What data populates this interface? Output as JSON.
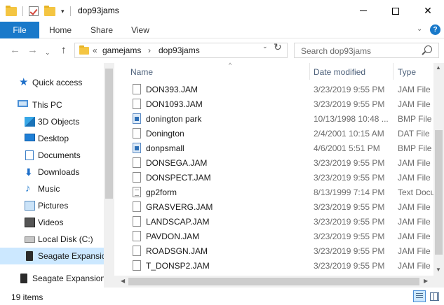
{
  "window": {
    "title": "dop93jams",
    "qa_dropdown_glyph": "▾",
    "minimize_label": "",
    "close_glyph": "✕"
  },
  "ribbon": {
    "tabs": [
      "File",
      "Home",
      "Share",
      "View"
    ],
    "expand_glyph": "⌄",
    "help_glyph": "?"
  },
  "address": {
    "back_glyph": "←",
    "forward_glyph": "→",
    "recent_glyph": "⌄",
    "up_glyph": "↑",
    "prefix": "«",
    "crumbs": [
      "gamejams",
      "dop93jams"
    ],
    "sep": "›",
    "chevron_glyph": "⌄",
    "refresh_glyph": "↻"
  },
  "search": {
    "placeholder": "Search dop93jams"
  },
  "nav": {
    "items": [
      {
        "label": "Quick access",
        "icon": "star-icon"
      },
      {
        "label": "This PC",
        "icon": "computer-icon"
      },
      {
        "label": "3D Objects",
        "icon": "3d-objects-icon"
      },
      {
        "label": "Desktop",
        "icon": "desktop-icon"
      },
      {
        "label": "Documents",
        "icon": "documents-icon"
      },
      {
        "label": "Downloads",
        "icon": "downloads-icon"
      },
      {
        "label": "Music",
        "icon": "music-icon"
      },
      {
        "label": "Pictures",
        "icon": "pictures-icon"
      },
      {
        "label": "Videos",
        "icon": "videos-icon"
      },
      {
        "label": "Local Disk (C:)",
        "icon": "disk-icon"
      },
      {
        "label": "Seagate Expansion",
        "icon": "drive-icon"
      },
      {
        "label": "Seagate Expansion D",
        "icon": "drive-icon"
      }
    ],
    "star_glyph": "★",
    "down_glyph": "⬇",
    "music_glyph": "♪"
  },
  "columns": {
    "name": "Name",
    "date": "Date modified",
    "type": "Type",
    "sort_glyph": "^"
  },
  "files": [
    {
      "name": "DON393.JAM",
      "date": "3/23/2019 9:55 PM",
      "type": "JAM File",
      "kind": "file"
    },
    {
      "name": "DON1093.JAM",
      "date": "3/23/2019 9:55 PM",
      "type": "JAM File",
      "kind": "file"
    },
    {
      "name": "donington park",
      "date": "10/13/1998 10:48 ...",
      "type": "BMP File",
      "kind": "bmp"
    },
    {
      "name": "Donington",
      "date": "2/4/2001 10:15 AM",
      "type": "DAT File",
      "kind": "file"
    },
    {
      "name": "donpsmall",
      "date": "4/6/2001 5:51 PM",
      "type": "BMP File",
      "kind": "bmp"
    },
    {
      "name": "DONSEGA.JAM",
      "date": "3/23/2019 9:55 PM",
      "type": "JAM File",
      "kind": "file"
    },
    {
      "name": "DONSPECT.JAM",
      "date": "3/23/2019 9:55 PM",
      "type": "JAM File",
      "kind": "file"
    },
    {
      "name": "gp2form",
      "date": "8/13/1999 7:14 PM",
      "type": "Text Docu",
      "kind": "txt"
    },
    {
      "name": "GRASVERG.JAM",
      "date": "3/23/2019 9:55 PM",
      "type": "JAM File",
      "kind": "file"
    },
    {
      "name": "LANDSCAP.JAM",
      "date": "3/23/2019 9:55 PM",
      "type": "JAM File",
      "kind": "file"
    },
    {
      "name": "PAVDON.JAM",
      "date": "3/23/2019 9:55 PM",
      "type": "JAM File",
      "kind": "file"
    },
    {
      "name": "ROADSGN.JAM",
      "date": "3/23/2019 9:55 PM",
      "type": "JAM File",
      "kind": "file"
    },
    {
      "name": "T_DONSP2.JAM",
      "date": "3/23/2019 9:55 PM",
      "type": "JAM File",
      "kind": "file"
    }
  ],
  "scroll_glyphs": {
    "up": "▲",
    "down": "▼",
    "left": "◀",
    "right": "▶"
  },
  "status": {
    "count": "19 items"
  }
}
